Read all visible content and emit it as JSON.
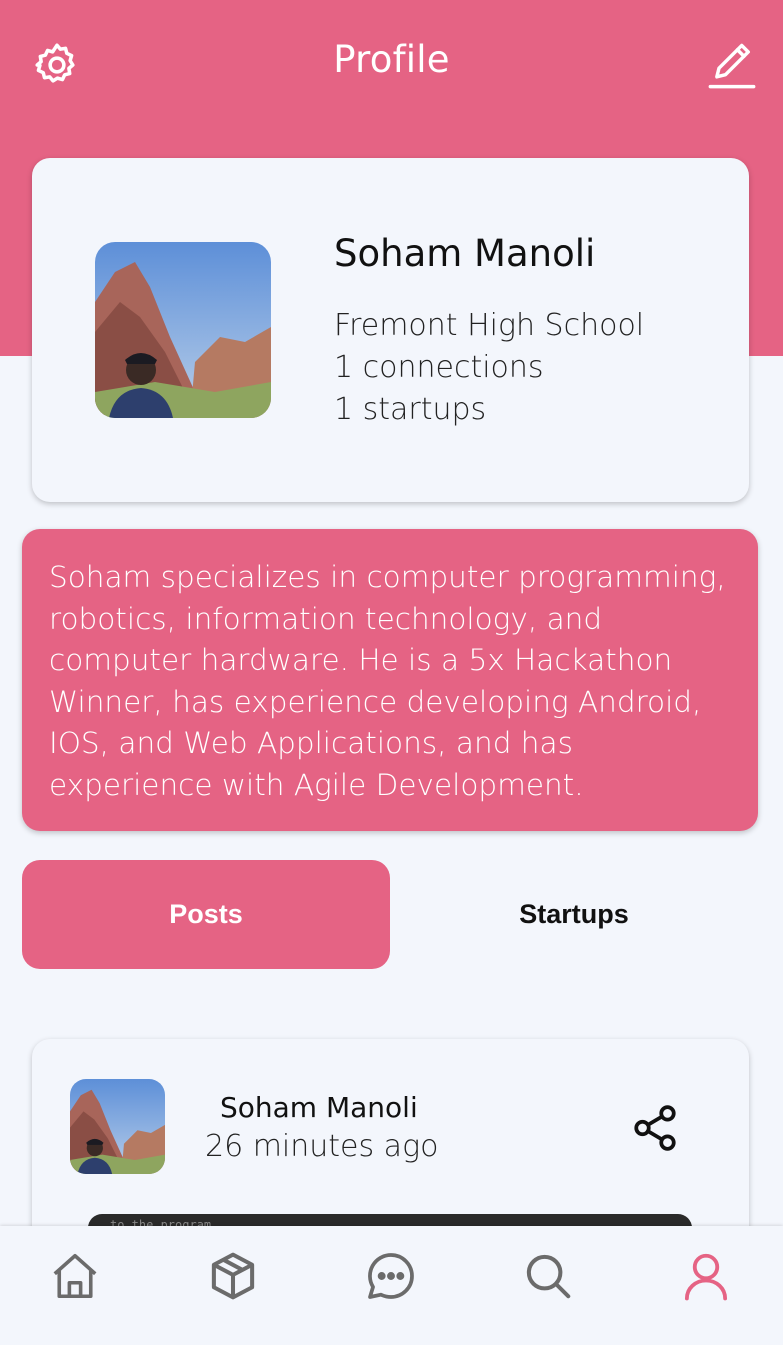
{
  "colors": {
    "accent": "#e56384",
    "background": "#f3f6fc",
    "icon_gray": "#6b6b6b",
    "text_dark": "#111111"
  },
  "header": {
    "title": "Profile",
    "left_icon": "settings-icon",
    "right_icon": "edit-icon"
  },
  "profile": {
    "name": "Soham Manoli",
    "school": "Fremont High School",
    "connections": "1 connections",
    "startups": "1 startups",
    "avatar": "profile-photo"
  },
  "bio": {
    "text": "Soham specializes in computer programming, robotics, information technology, and computer hardware. He is a 5x Hackathon Winner, has experience developing Android, IOS, and Web Applications, and has experience with Agile Development."
  },
  "tabs": [
    {
      "label": "Posts",
      "selected": true
    },
    {
      "label": "Startups",
      "selected": false
    }
  ],
  "post": {
    "author": "Soham Manoli",
    "time": "26 minutes ago",
    "share_icon": "share-icon",
    "media_snippet": "to the program"
  },
  "bottom_nav": [
    {
      "icon": "home-icon",
      "active": false
    },
    {
      "icon": "cube-icon",
      "active": false
    },
    {
      "icon": "chat-icon",
      "active": false
    },
    {
      "icon": "search-icon",
      "active": false
    },
    {
      "icon": "user-icon",
      "active": true
    }
  ]
}
